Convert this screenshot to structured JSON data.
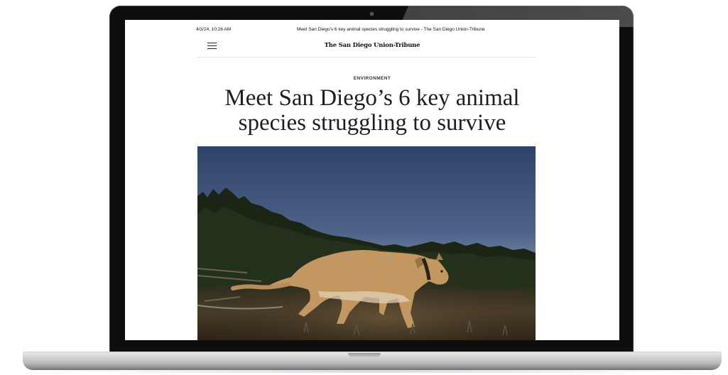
{
  "browser_print": {
    "datetime": "4/3/24, 10:26 AM",
    "page_title": "Meet San Diego's 6 key animal species struggling to survive - The San Diego Union-Tribune"
  },
  "site": {
    "masthead": "The San Diego Union-Tribune",
    "menu_icon": "hamburger-menu-icon"
  },
  "article": {
    "section": "ENVIRONMENT",
    "headline_line1": "Meet San Diego’s 6 key animal",
    "headline_line2": "species struggling to survive"
  },
  "colors": {
    "sky_top": "#33466f",
    "sky_bottom": "#a9b9cf",
    "ground": "#3a3121",
    "puma": "#c49a63",
    "bezel": "#0e0e0f",
    "aluminum": "#c9c9cb"
  }
}
